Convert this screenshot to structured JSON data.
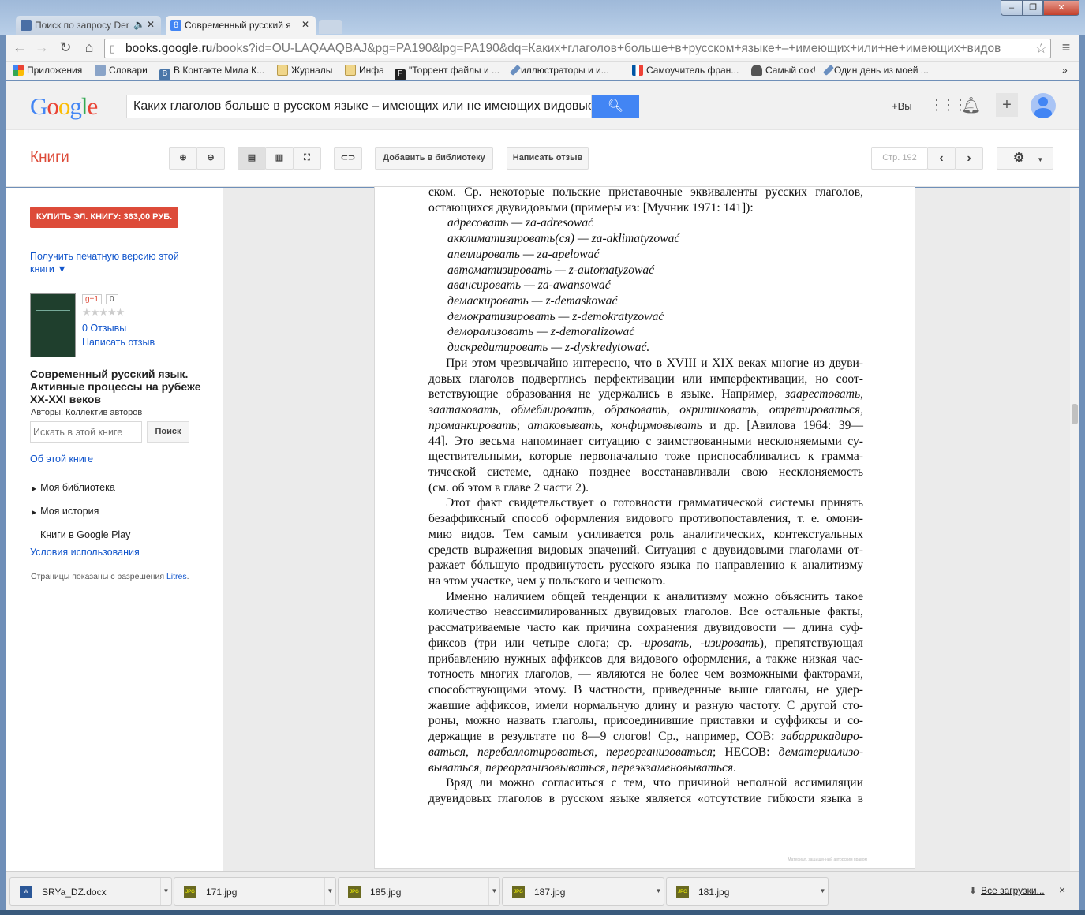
{
  "browser": {
    "tabs": [
      {
        "label": "Поиск по запросу Der",
        "icon": "video-icon",
        "audio": "speaker-icon"
      },
      {
        "label": "Современный русский я",
        "icon": "google-books-icon"
      }
    ],
    "url_host": "books.google.ru",
    "url_rest": "/books?id=OU-LAQAAQBAJ&pg=PA190&lpg=PA190&dq=Каких+глаголов+больше+в+русском+языке+–+имеющих+или+не+имеющих+видов",
    "bookmarks": [
      "Приложения",
      "Словари",
      "В Контакте Мила К...",
      "Журналы",
      "Инфа",
      "\"Торрент файлы и ...",
      "иллюстраторы и и...",
      "Самоучитель фран...",
      "Самый сок!",
      "Один день из моей ..."
    ],
    "bookmarks_more": "»"
  },
  "google": {
    "logo": "Google",
    "query": "Каких глаголов больше в русском языке – имеющих или не имеющих видовые п",
    "plus_you": "+Вы"
  },
  "books": {
    "brand": "Книги",
    "add_to_library": "Добавить в библиотеку",
    "write_review": "Написать отзыв",
    "page_label": "Стр. 192"
  },
  "sidebar": {
    "buy": "КУПИТЬ ЭЛ. КНИГУ: 363,00 РУБ.",
    "print_version": "Получить печатную версию этой книги ▼",
    "gplus": "g+1",
    "gplus_count": "0",
    "stars": "★★★★★",
    "rating": 0,
    "reviews": "0 Отзывы",
    "write_review": "Написать отзыв",
    "title": "Современный русский язык. Активные процессы на рубеже XX-XXI веков",
    "authors": "Авторы: Коллектив авторов",
    "search_placeholder": "Искать в этой книге",
    "search_button": "Поиск",
    "about": "Об этой книге",
    "my_library": "Моя библиотека",
    "my_history": "Моя история",
    "play": "Книги в Google Play",
    "terms": "Условия использования",
    "permission": "Страницы показаны с разрешения ",
    "permission_link": "Litres",
    "permission_end": "."
  },
  "page": {
    "watermark": "Материал, защищенный авторским правом",
    "blocks": [
      {
        "kind": "cont",
        "lines": [
          [
            "ском. Ср. некоторые польские приставочные эквиваленты русских глаголов,"
          ],
          [
            "остающихся двувидовыми (примеры из: [Мучник 1971: 141]):"
          ]
        ]
      },
      {
        "kind": "list",
        "lines": [
          [
            {
              "i": "адресовать — za-adresować"
            }
          ],
          [
            {
              "i": "акклиматизировать(ся) — za-aklimatyzować"
            }
          ],
          [
            {
              "i": "апеллировать — za-apelować"
            }
          ],
          [
            {
              "i": "автоматизировать — z-automatyzować"
            }
          ],
          [
            {
              "i": "авансировать — za-awansować"
            }
          ],
          [
            {
              "i": "демаскировать — z-demaskować"
            }
          ],
          [
            {
              "i": "демократизировать — z-demokratyzować"
            }
          ],
          [
            {
              "i": "деморализовать — z-demoralizować"
            }
          ],
          [
            {
              "i": "дискредитировать — z-dyskredytować."
            }
          ]
        ]
      },
      {
        "kind": "para",
        "lines": [
          [
            "При этом чрезвычайно интересно, что в XVIII и XIX веках многие из двуви-"
          ],
          [
            "довых глаголов подверглись перфективации или имперфективации, но соот-"
          ],
          [
            "ветствующие образования не удержались в языке. Например, ",
            {
              "i": "заарестовать"
            },
            ","
          ],
          [
            {
              "i": "заатаковать"
            },
            ", ",
            {
              "i": "обмеблировать"
            },
            ", ",
            {
              "i": "обраковать"
            },
            ", ",
            {
              "i": "окритиковать"
            },
            ", ",
            {
              "i": "отретироваться"
            },
            ","
          ],
          [
            {
              "i": "проманкировать"
            },
            "; ",
            {
              "i": "атаковывать"
            },
            ", ",
            {
              "i": "конфирмовывать"
            },
            " и др. [Авилова 1964: 39—"
          ],
          [
            "44]. Это весьма напоминает ситуацию с заимствованными несклоняемыми су-"
          ],
          [
            "ществительными, которые первоначально тоже приспосабливались к грамма-"
          ],
          [
            "тической системе, однако позднее восстанавливали свою несклоняемость"
          ],
          [
            "(см. об этом в главе 2 части 2)."
          ]
        ]
      },
      {
        "kind": "para",
        "lines": [
          [
            "Этот факт свидетельствует о готовности грамматической системы принять"
          ],
          [
            "безаффиксный способ оформления видового противопоставления, т. е. омони-"
          ],
          [
            "мию видов. Тем самым усиливается роль аналитических, контекстуальных"
          ],
          [
            "средств выражения видовых значений. Ситуация с двувидовыми глаголами от-"
          ],
          [
            "ражает бóльшую продвинутость русского языка по направлению к аналитизму"
          ],
          [
            "на этом участке, чем у польского и чешского."
          ]
        ]
      },
      {
        "kind": "para",
        "lines": [
          [
            "Именно наличием общей тенденции к аналитизму можно объяснить такое"
          ],
          [
            "количество неассимилированных двувидовых глаголов. Все остальные факты,"
          ],
          [
            "рассматриваемые часто как причина сохранения двувидовости — длина суф-"
          ],
          [
            "фиксов (три или четыре слога; ср. ",
            {
              "i": "-ировать"
            },
            ", ",
            {
              "i": "-изировать"
            },
            "), препятствующая"
          ],
          [
            "прибавлению нужных аффиксов для видового оформления, а также низкая час-"
          ],
          [
            "тотность многих глаголов, — являются не более чем возможными факторами,"
          ],
          [
            "способствующими этому. В частности, приведенные выше глаголы, не удер-"
          ],
          [
            "жавшие аффиксов, имели нормальную длину и разную частоту. С другой сто-"
          ],
          [
            "роны, можно назвать глаголы, присоединившие приставки и суффиксы и со-"
          ],
          [
            "держащие в результате по 8—9 слогов! Ср., например, СОВ: ",
            {
              "i": "забаррикадиро-"
            }
          ],
          [
            {
              "i": "ваться"
            },
            ", ",
            {
              "i": "перебаллотироваться"
            },
            ", ",
            {
              "i": "переорганизоваться"
            },
            "; НЕСОВ: ",
            {
              "i": "дематериализо-"
            }
          ],
          [
            {
              "i": "вываться"
            },
            ", ",
            {
              "i": "переорганизовываться"
            },
            ", ",
            {
              "i": "переэкзаменовываться"
            },
            "."
          ]
        ]
      },
      {
        "kind": "para-open",
        "lines": [
          [
            "Вряд ли можно согласиться с тем, что причиной неполной ассимиляции"
          ],
          [
            "двувидовых глаголов в русском языке является «отсутствие гибкости языка в"
          ]
        ]
      }
    ]
  },
  "downloads": {
    "items": [
      "SRYa_DZ.docx",
      "171.jpg",
      "185.jpg",
      "187.jpg",
      "181.jpg"
    ],
    "all": "Все загрузки...",
    "close": "×"
  },
  "colors": {
    "google_blue": "#4285f4",
    "buy_red": "#dd4b39",
    "link": "#1155cc",
    "brand_red": "#dd4b39"
  }
}
